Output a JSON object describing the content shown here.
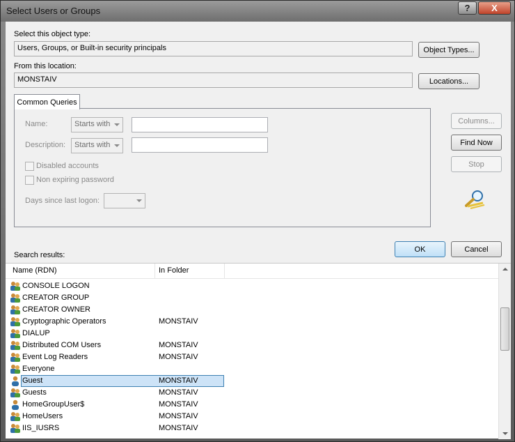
{
  "window": {
    "title": "Select Users or Groups",
    "help_glyph": "?",
    "close_glyph": "X"
  },
  "object_type": {
    "label": "Select this object type:",
    "value": "Users, Groups, or Built-in security principals",
    "button": "Object Types..."
  },
  "location": {
    "label": "From this location:",
    "value": "MONSTAIV",
    "button": "Locations..."
  },
  "common_queries": {
    "tab_label": "Common Queries",
    "name_label": "Name:",
    "name_mode": "Starts with",
    "name_value": "",
    "description_label": "Description:",
    "description_mode": "Starts with",
    "description_value": "",
    "disabled_accounts_label": "Disabled accounts",
    "non_expiring_label": "Non expiring password",
    "days_label": "Days since last logon:",
    "days_value": ""
  },
  "side_buttons": {
    "columns": "Columns...",
    "find_now": "Find Now",
    "stop": "Stop"
  },
  "dialog_buttons": {
    "ok": "OK",
    "cancel": "Cancel"
  },
  "search_results": {
    "label": "Search results:",
    "columns": [
      "Name (RDN)",
      "In Folder"
    ],
    "rows": [
      {
        "name": "CONSOLE LOGON",
        "folder": "",
        "icon": "group-icon"
      },
      {
        "name": "CREATOR GROUP",
        "folder": "",
        "icon": "group-icon"
      },
      {
        "name": "CREATOR OWNER",
        "folder": "",
        "icon": "group-icon"
      },
      {
        "name": "Cryptographic Operators",
        "folder": "MONSTAIV",
        "icon": "group-icon"
      },
      {
        "name": "DIALUP",
        "folder": "",
        "icon": "group-icon"
      },
      {
        "name": "Distributed COM Users",
        "folder": "MONSTAIV",
        "icon": "group-icon"
      },
      {
        "name": "Event Log Readers",
        "folder": "MONSTAIV",
        "icon": "group-icon"
      },
      {
        "name": "Everyone",
        "folder": "",
        "icon": "group-icon"
      },
      {
        "name": "Guest",
        "folder": "MONSTAIV",
        "icon": "user-icon",
        "selected": true
      },
      {
        "name": "Guests",
        "folder": "MONSTAIV",
        "icon": "group-icon"
      },
      {
        "name": "HomeGroupUser$",
        "folder": "MONSTAIV",
        "icon": "user-icon"
      },
      {
        "name": "HomeUsers",
        "folder": "MONSTAIV",
        "icon": "group-icon"
      },
      {
        "name": "IIS_IUSRS",
        "folder": "MONSTAIV",
        "icon": "group-icon"
      }
    ]
  },
  "colors": {
    "selection_border": "#3c7fb1",
    "selection_fill": "#cde3f7",
    "default_button_border": "#3c7fb1"
  }
}
